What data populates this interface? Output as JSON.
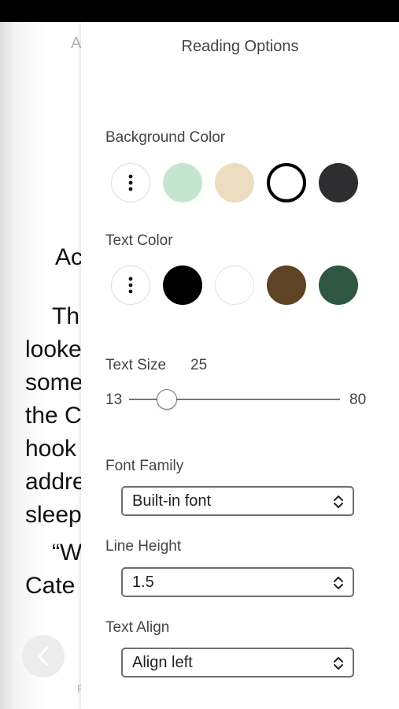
{
  "reader": {
    "header_fragment": "A",
    "text_fragments": [
      "Ac",
      "Th",
      "looke",
      "some",
      "the C",
      "hook",
      "addre",
      "sleep",
      "“W",
      "Cate"
    ],
    "back_icon": "chevron-left-icon",
    "footer_fragment": "F"
  },
  "panel": {
    "title": "Reading Options",
    "background_color": {
      "label": "Background Color",
      "more_icon": "more-vertical-icon",
      "swatches": [
        "#c4e6d0",
        "#ecdcc0",
        "#ffffff",
        "#2e2e30"
      ],
      "selected": "#ffffff"
    },
    "text_color": {
      "label": "Text Color",
      "more_icon": "more-vertical-icon",
      "swatches": [
        "#000000",
        "#ffffff",
        "#5e4324",
        "#2e5640"
      ]
    },
    "text_size": {
      "label": "Text Size",
      "value": "25",
      "min": "13",
      "max": "80"
    },
    "font_family": {
      "label": "Font Family",
      "selected": "Built-in font"
    },
    "line_height": {
      "label": "Line Height",
      "selected": "1.5"
    },
    "text_align": {
      "label": "Text Align",
      "selected": "Align left"
    }
  }
}
